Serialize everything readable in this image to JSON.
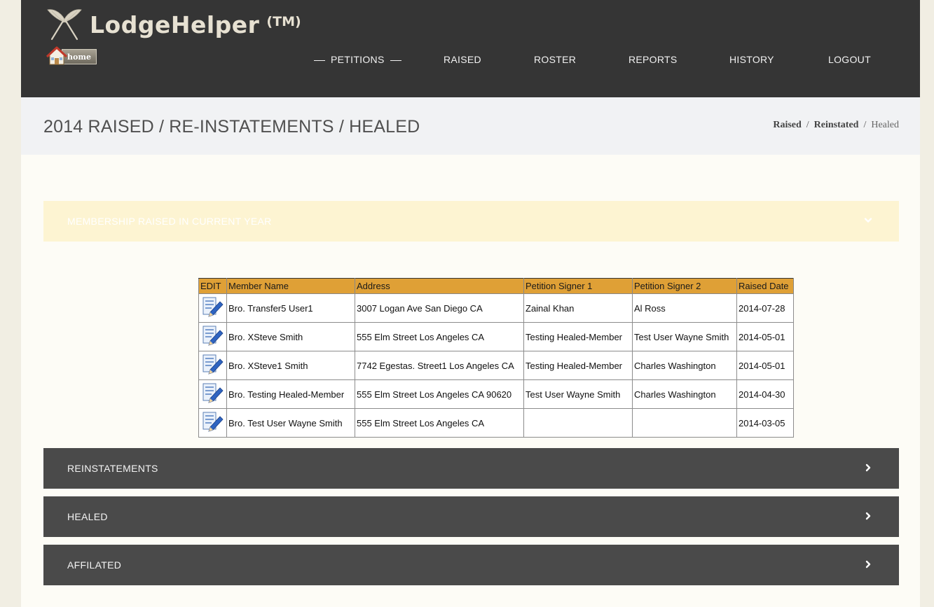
{
  "app": {
    "name": "LodgeHelper",
    "trademark": "(TM)",
    "home_label": "home"
  },
  "nav": {
    "items": [
      {
        "label": "PETITIONS",
        "active": true
      },
      {
        "label": "RAISED"
      },
      {
        "label": "ROSTER"
      },
      {
        "label": "REPORTS"
      },
      {
        "label": "HISTORY"
      },
      {
        "label": "LOGOUT"
      }
    ]
  },
  "page": {
    "title": "2014 RAISED / RE-INSTATEMENTS / HEALED"
  },
  "breadcrumb": {
    "items": [
      "Raised",
      "Reinstated",
      "Healed"
    ],
    "separator": "/"
  },
  "sections": {
    "raised": {
      "label": "MEMBERSHIP RAISED IN CURRENT YEAR",
      "expanded": true
    },
    "reinstatements": {
      "label": "REINSTATEMENTS",
      "expanded": false
    },
    "healed": {
      "label": "HEALED",
      "expanded": false
    },
    "affiliated": {
      "label": "AFFILATED",
      "expanded": false
    }
  },
  "table": {
    "columns": [
      "EDIT",
      "Member Name",
      "Address",
      "Petition Signer 1",
      "Petition Signer 2",
      "Raised Date"
    ],
    "rows": [
      {
        "name": "Bro. Transfer5 User1",
        "address": "3007 Logan Ave San Diego CA",
        "signer1": "Zainal Khan",
        "signer2": "Al Ross",
        "date": "2014-07-28"
      },
      {
        "name": "Bro. XSteve Smith",
        "address": "555 Elm Street Los Angeles CA",
        "signer1": "Testing Healed-Member",
        "signer2": "Test User Wayne Smith",
        "date": "2014-05-01"
      },
      {
        "name": "Bro. XSteve1 Smith",
        "address": "7742 Egestas. Street1 Los Angeles CA",
        "signer1": "Testing Healed-Member",
        "signer2": "Charles Washington",
        "date": "2014-05-01"
      },
      {
        "name": "Bro. Testing Healed-Member",
        "address": "555 Elm Street Los Angeles CA 90620",
        "signer1": "Test User Wayne Smith",
        "signer2": "Charles Washington",
        "date": "2014-04-30"
      },
      {
        "name": "Bro. Test User Wayne Smith",
        "address": "555 Elm Street Los Angeles CA",
        "signer1": "",
        "signer2": "",
        "date": "2014-03-05"
      }
    ]
  },
  "colors": {
    "header_bg": "#353535",
    "table_header": "#dfa036",
    "open_section_bg": "#fdf4d2",
    "closed_section_bg": "#4a4a4a"
  }
}
